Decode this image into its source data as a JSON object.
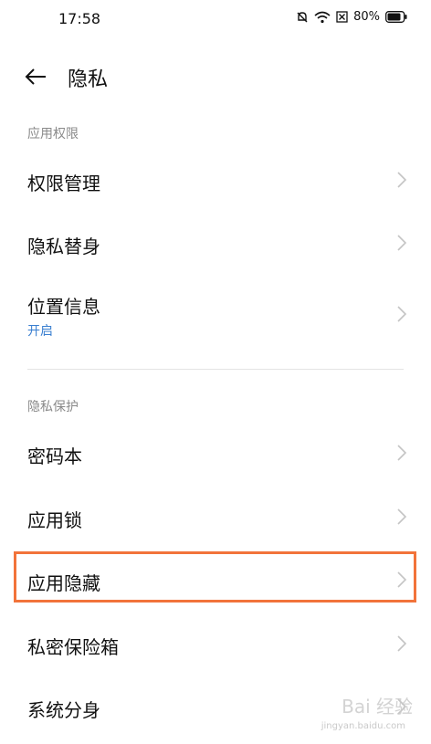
{
  "status_bar": {
    "time": "17:58",
    "battery": "80%"
  },
  "header": {
    "title": "隐私"
  },
  "sections": {
    "app_permissions": "应用权限",
    "privacy_protection": "隐私保护"
  },
  "items": [
    {
      "label": "权限管理"
    },
    {
      "label": "隐私替身"
    },
    {
      "label": "位置信息",
      "sub": "开启"
    },
    {
      "label": "密码本"
    },
    {
      "label": "应用锁"
    },
    {
      "label": "应用隐藏"
    },
    {
      "label": "私密保险箱"
    },
    {
      "label": "系统分身"
    }
  ],
  "colors": {
    "accent": "#3a7fd0",
    "highlight": "#f2733a"
  },
  "watermark": {
    "main": "Bai 经验",
    "sub": "jingyan.baidu.com"
  }
}
